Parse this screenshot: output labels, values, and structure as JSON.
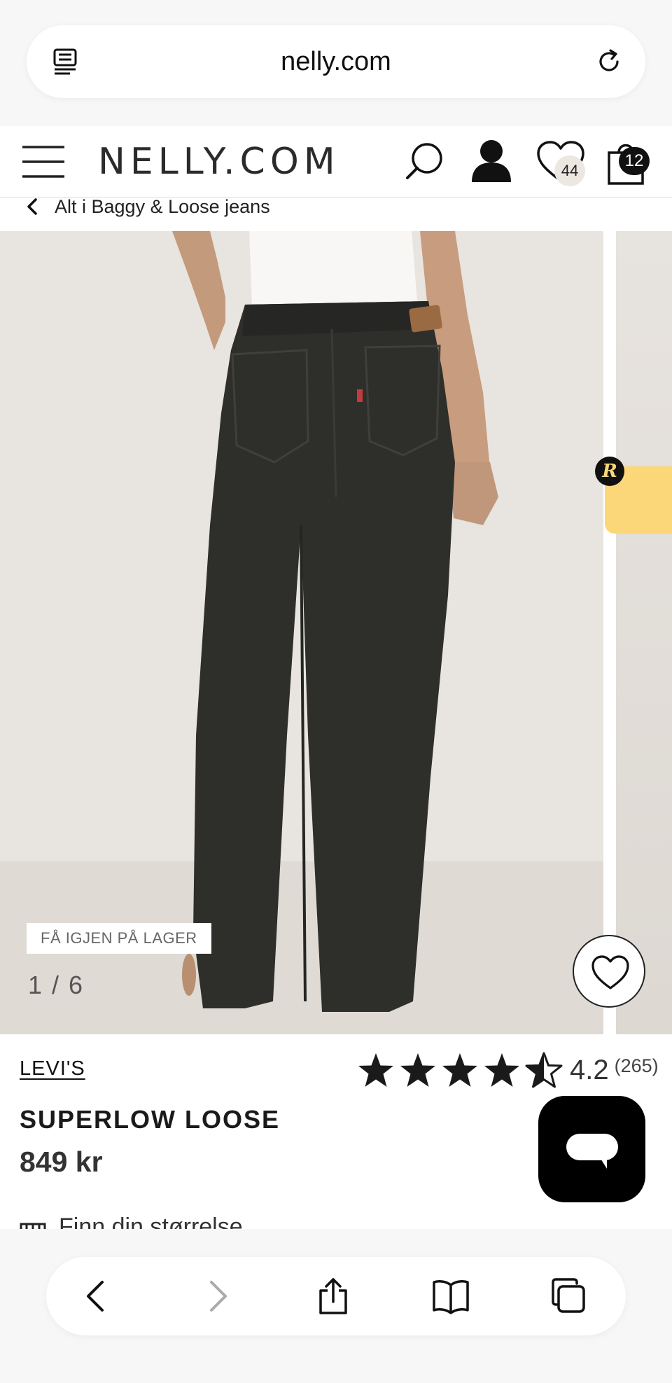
{
  "browser": {
    "url": "nelly.com",
    "icons": {
      "reader": "reader-mode-icon",
      "reload": "reload-icon"
    }
  },
  "header": {
    "logo": "NELLY.COM",
    "wishlist_count": "44",
    "bag_count": "12",
    "icons": [
      "menu-icon",
      "search-icon",
      "user-icon",
      "heart-icon",
      "bag-icon"
    ]
  },
  "breadcrumb": {
    "label": "Alt i Baggy & Loose jeans"
  },
  "gallery": {
    "stock_badge": "FÅ IGJEN PÅ LAGER",
    "counter": "1 / 6",
    "current": 1,
    "total": 6,
    "badge_letter": "R"
  },
  "product": {
    "brand": "LEVI'S",
    "name": "SUPERLOW LOOSE",
    "price": "849 kr",
    "rating": "4.2",
    "rating_value": 4.2,
    "rating_max": 5,
    "review_count": "(265)",
    "size_finder": "Finn din størrelse"
  },
  "colors": {
    "accent_badge": "#fcd77a",
    "text": "#1a1a1a",
    "chat_button": "#000000"
  },
  "toolbar": {
    "icons": [
      "back-icon",
      "forward-icon",
      "share-icon",
      "bookmarks-icon",
      "tabs-icon"
    ]
  }
}
